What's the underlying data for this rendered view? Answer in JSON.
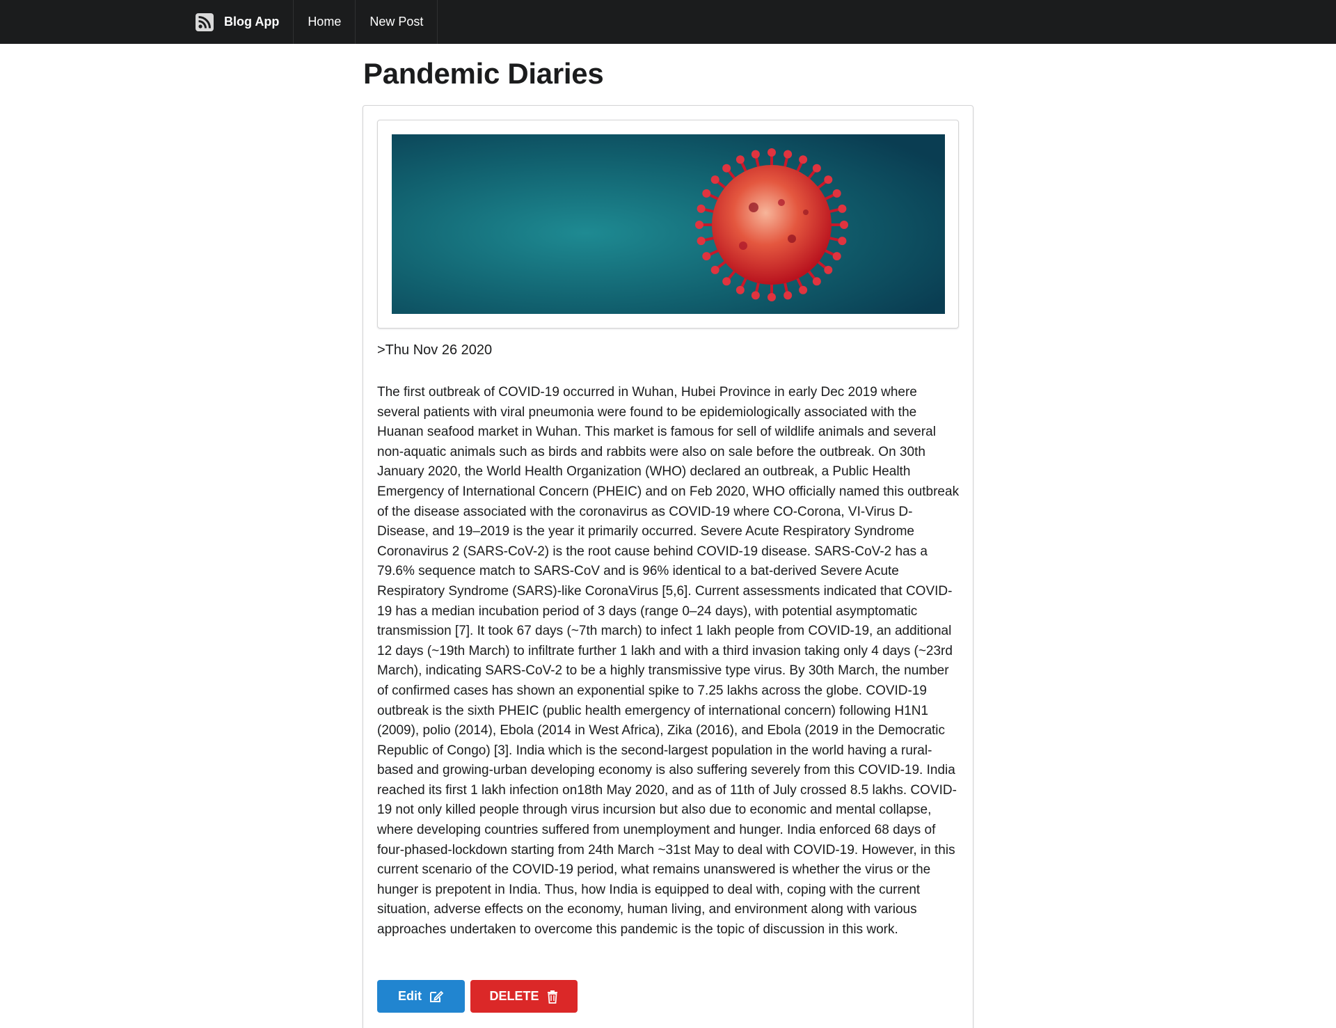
{
  "navbar": {
    "brand": "Blog App",
    "brand_icon": "rss-icon",
    "items": [
      {
        "label": "Home"
      },
      {
        "label": "New Post"
      }
    ]
  },
  "page": {
    "title": "Pandemic Diaries"
  },
  "post": {
    "image_description": "coronavirus-illustration",
    "date": ">Thu Nov 26 2020",
    "body": "The first outbreak of COVID-19 occurred in Wuhan, Hubei Province in early Dec 2019 where several patients with viral pneumonia were found to be epidemiologically associated with the Huanan seafood market in Wuhan. This market is famous for sell of wildlife animals and several non-aquatic animals such as birds and rabbits were also on sale before the outbreak. On 30th January 2020, the World Health Organization (WHO) declared an outbreak, a Public Health Emergency of International Concern (PHEIC) and on Feb 2020, WHO officially named this outbreak of the disease associated with the coronavirus as COVID-19 where CO-Corona, VI-Virus D- Disease, and 19–2019 is the year it primarily occurred. Severe Acute Respiratory Syndrome Coronavirus 2 (SARS-CoV-2) is the root cause behind COVID-19 disease. SARS-CoV-2 has a 79.6% sequence match to SARS-CoV and is 96% identical to a bat-derived Severe Acute Respiratory Syndrome (SARS)-like CoronaVirus [5,6]. Current assessments indicated that COVID-19 has a median incubation period of 3 days (range 0–24 days), with potential asymptomatic transmission [7]. It took 67 days (~7th march) to infect 1 lakh people from COVID-19, an additional 12 days (~19th March) to infiltrate further 1 lakh and with a third invasion taking only 4 days (~23rd March), indicating SARS-CoV-2 to be a highly transmissive type virus. By 30th March, the number of confirmed cases has shown an exponential spike to 7.25 lakhs across the globe. COVID-19 outbreak is the sixth PHEIC (public health emergency of international concern) following H1N1 (2009), polio (2014), Ebola (2014 in West Africa), Zika (2016), and Ebola (2019 in the Democratic Republic of Congo) [3]. India which is the second-largest population in the world having a rural-based and growing-urban developing economy is also suffering severely from this COVID-19. India reached its first 1 lakh infection on18th May 2020, and as of 11th of July crossed 8.5 lakhs. COVID-19 not only killed people through virus incursion but also due to economic and mental collapse, where developing countries suffered from unemployment and hunger. India enforced 68 days of four-phased-lockdown starting from 24th March ~31st May to deal with COVID-19. However, in this current scenario of the COVID-19 period, what remains unanswered is whether the virus or the hunger is prepotent in India. Thus, how India is equipped to deal with, coping with the current situation, adverse effects on the economy, human living, and environment along with various approaches undertaken to overcome this pandemic is the topic of discussion in this work."
  },
  "actions": {
    "edit_label": "Edit",
    "edit_icon": "edit-icon",
    "delete_label": "DELETE",
    "delete_icon": "trash-icon"
  },
  "colors": {
    "navbar": "#1b1c1d",
    "edit_button": "#2185d0",
    "delete_button": "#db2828"
  }
}
